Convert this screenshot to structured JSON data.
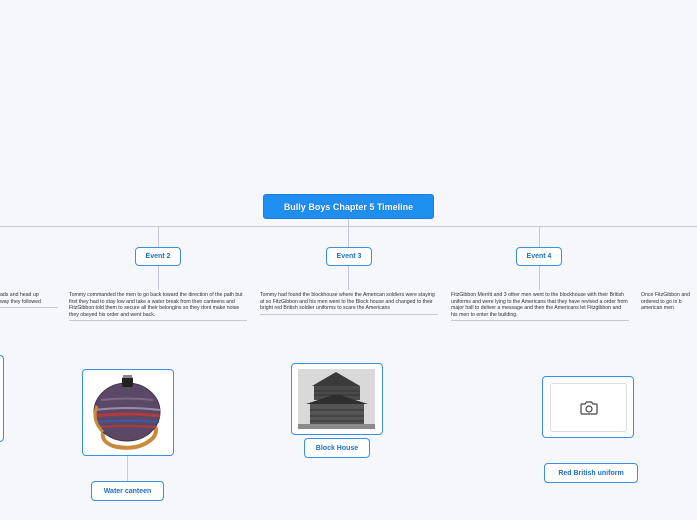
{
  "root": {
    "title": "Bully Boys Chapter 5 Timeline"
  },
  "events": [
    {
      "label": "Event 2"
    },
    {
      "label": "Event 3"
    },
    {
      "label": "Event 4"
    }
  ],
  "descriptions": {
    "left_partial": "ads and head up\nway they followed",
    "event2": "Tommy commanded the men to go back toward the direction of the path but first they had to stay low and take a water break from their canteens and FitzGibbon told them to secure all their belongins so they dont make noise they obeyed his order and went back.",
    "event3": "Tommy had found the blockhouse where the American soldiers were staying at so FitzGibbon and his men went to the Block house and changed to their bright red British soldier uniforms to scare the Americans",
    "event4": "FitzGibbon Merritt and 3 other men went to the blockhouse with their British uniforms and were lying to the Americans that they have revived a order from major hall to deliver a message and then the Americans let Fitzgibbon and his men to enter the building.",
    "right_partial": "Once FitzGibbon and\nordered to go in b\namerican men"
  },
  "images": [
    {
      "label": "Water canteen",
      "icon": "canteen-image"
    },
    {
      "label": "Block House",
      "icon": "blockhouse-image"
    },
    {
      "label": "Red British uniform",
      "icon": "camera-icon"
    }
  ]
}
